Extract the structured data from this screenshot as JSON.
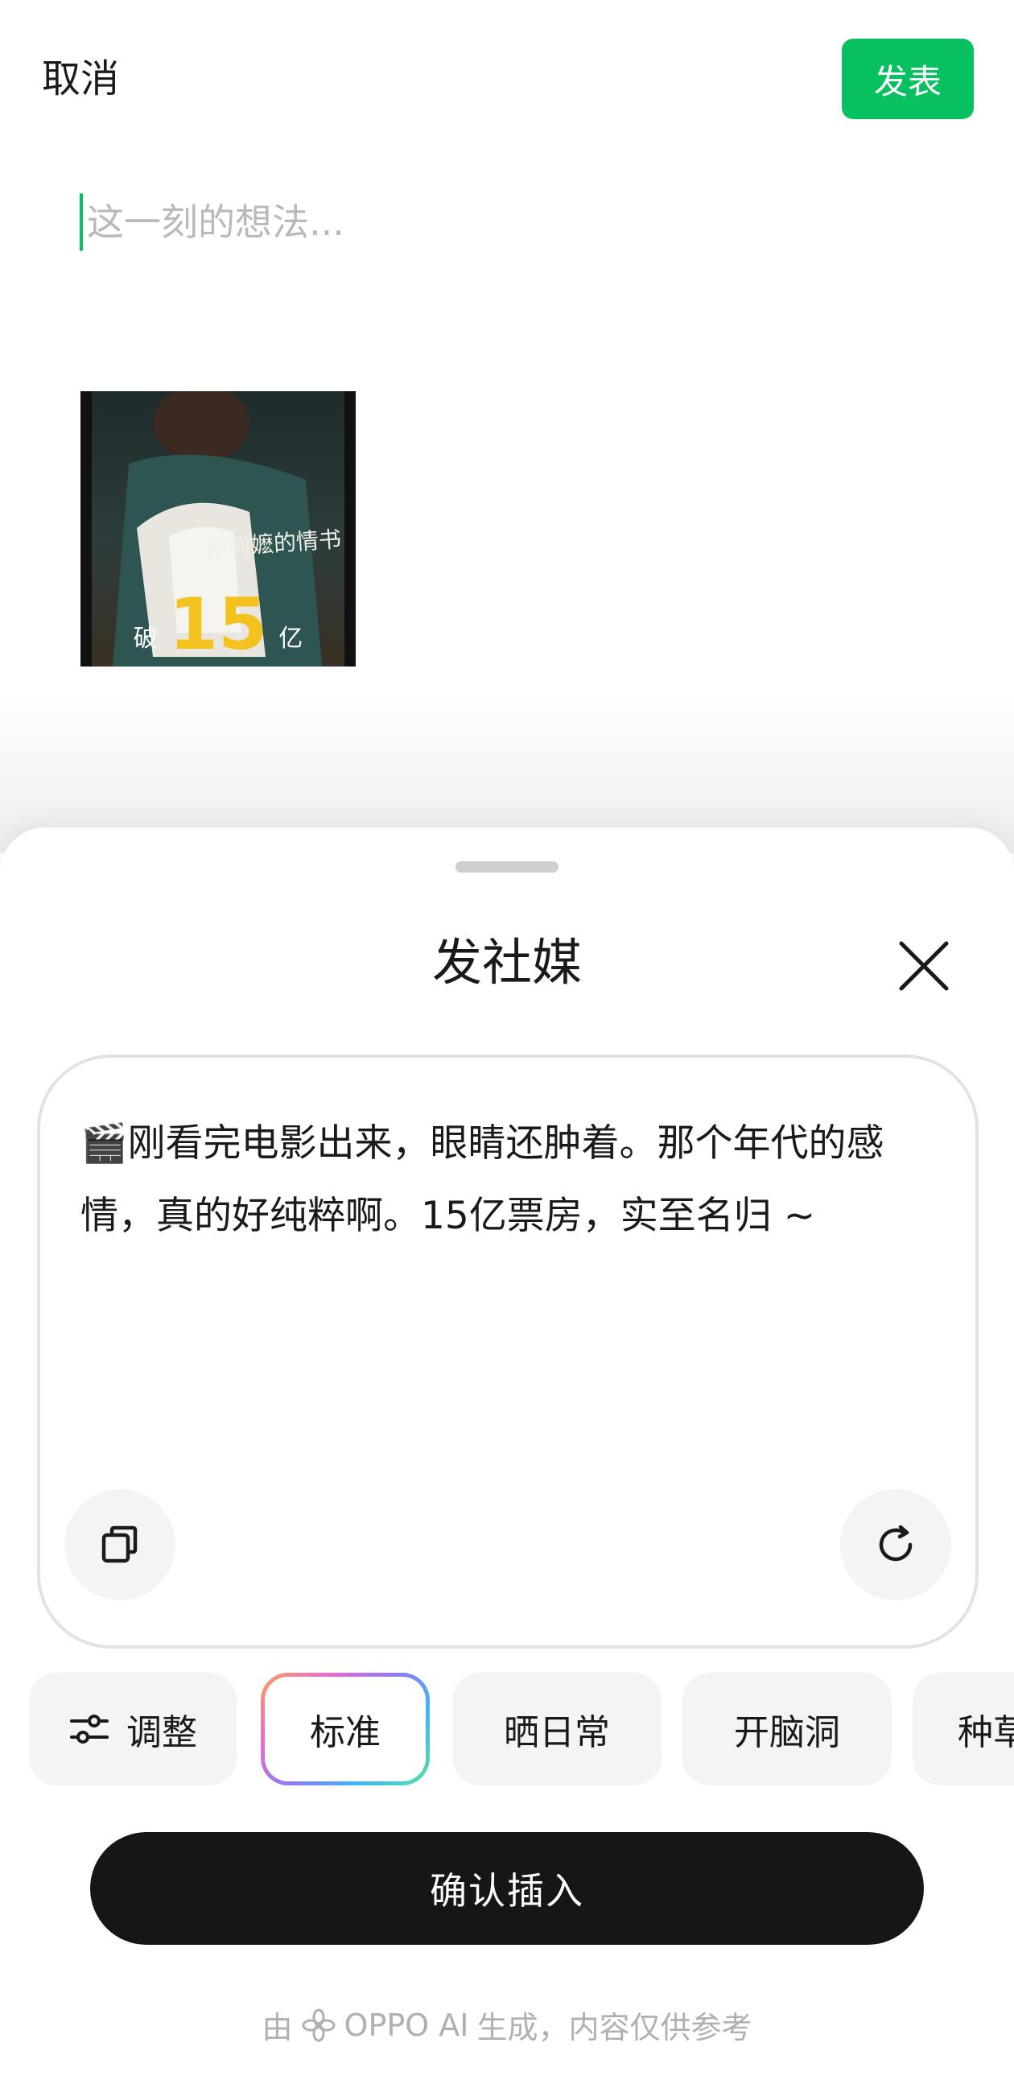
{
  "header": {
    "cancel_label": "取消",
    "publish_label": "发表"
  },
  "compose": {
    "placeholder": "这一刻的想法..."
  },
  "attachment": {
    "title_text": "给阿嬷的情书",
    "caption_left": "破",
    "caption_number": "15",
    "caption_right": "亿"
  },
  "sheet": {
    "title": "发社媒",
    "generated_text": "🎬刚看完电影出来，眼睛还肿着。那个年代的感情，真的好纯粹啊。15亿票房，实至名归 ~",
    "styles": [
      {
        "label": "调整",
        "icon": "sliders-icon"
      },
      {
        "label": "标准",
        "selected": true
      },
      {
        "label": "晒日常"
      },
      {
        "label": "开脑洞"
      },
      {
        "label": "种草"
      }
    ],
    "confirm_label": "确认插入",
    "footer_prefix": "由",
    "footer_brand": "OPPO AI",
    "footer_suffix": "生成，内容仅供参考"
  },
  "colors": {
    "publish_green": "#07c160",
    "confirm_black": "#161616",
    "poster_gold": "#f3c21e"
  }
}
